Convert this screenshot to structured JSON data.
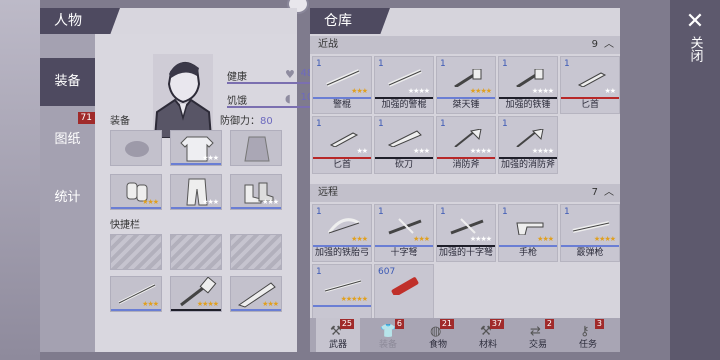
{
  "character": {
    "title": "人物",
    "tabs": [
      {
        "label": "装备"
      },
      {
        "label": "图纸",
        "badge": "71"
      },
      {
        "label": "统计"
      }
    ],
    "stats": {
      "health": {
        "label": "健康",
        "value": "480/485"
      },
      "hunger": {
        "label": "饥饿",
        "value": "105/200"
      }
    },
    "equipment_label": "装备",
    "defense_label": "防御力：",
    "defense_value": "80",
    "quickbar_label": "快捷栏"
  },
  "warehouse": {
    "title": "仓库",
    "sections": {
      "melee": {
        "label": "近战",
        "count": "9"
      },
      "ranged": {
        "label": "远程",
        "count": "7"
      }
    },
    "melee_items": [
      {
        "qty": "1",
        "name": "警棍",
        "icon": "baton-icon",
        "stars": "★★★",
        "bar": "blue"
      },
      {
        "qty": "1",
        "name": "加强的警棍",
        "icon": "baton-icon",
        "stars": "★★★★",
        "bar": "dark"
      },
      {
        "qty": "1",
        "name": "桀天锤",
        "icon": "hammer-icon",
        "stars": "★★★★",
        "bar": "blue"
      },
      {
        "qty": "1",
        "name": "加强的铁锤",
        "icon": "hammer-icon",
        "stars": "★★★★",
        "bar": "dark"
      },
      {
        "qty": "1",
        "name": "匕首",
        "icon": "knife-icon",
        "stars": "★★",
        "bar": "red"
      },
      {
        "qty": "1",
        "name": "匕首",
        "icon": "knife-icon",
        "stars": "★★",
        "bar": "red"
      },
      {
        "qty": "1",
        "name": "砍刀",
        "icon": "machete-icon",
        "stars": "★★★",
        "bar": "dark"
      },
      {
        "qty": "1",
        "name": "消防斧",
        "icon": "axe-icon",
        "stars": "★★★★",
        "bar": "red"
      },
      {
        "qty": "1",
        "name": "加强的消防斧",
        "icon": "axe-icon",
        "stars": "★★★★",
        "bar": "dark"
      }
    ],
    "ranged_items": [
      {
        "qty": "1",
        "name": "加强的铁胎弓",
        "icon": "bow-icon",
        "stars": "★★★",
        "bar": "blue"
      },
      {
        "qty": "1",
        "name": "十字弩",
        "icon": "crossbow-icon",
        "stars": "★★★",
        "bar": "blue"
      },
      {
        "qty": "1",
        "name": "加强的十字弩",
        "icon": "crossbow-icon",
        "stars": "★★★★",
        "bar": "dark"
      },
      {
        "qty": "1",
        "name": "手枪",
        "icon": "pistol-icon",
        "stars": "★★★",
        "bar": "blue"
      },
      {
        "qty": "1",
        "name": "霰弹枪",
        "icon": "shotgun-icon",
        "stars": "★★★★",
        "bar": "blue"
      },
      {
        "qty": "1",
        "name": "",
        "icon": "rifle-icon",
        "stars": "★★★★★",
        "bar": "blue"
      },
      {
        "qty": "607",
        "name": "",
        "icon": "ammo-icon",
        "stars": "",
        "bar": "none"
      }
    ],
    "categories": [
      {
        "label": "武器",
        "badge": "25",
        "icon": "weapon-icon"
      },
      {
        "label": "装备",
        "badge": "6",
        "icon": "shirt-icon"
      },
      {
        "label": "食物",
        "badge": "21",
        "icon": "food-icon"
      },
      {
        "label": "材料",
        "badge": "37",
        "icon": "hammer-icon"
      },
      {
        "label": "交易",
        "badge": "2",
        "icon": "trade-icon"
      },
      {
        "label": "任务",
        "badge": "3",
        "icon": "key-icon"
      }
    ]
  },
  "close_label": "关闭"
}
